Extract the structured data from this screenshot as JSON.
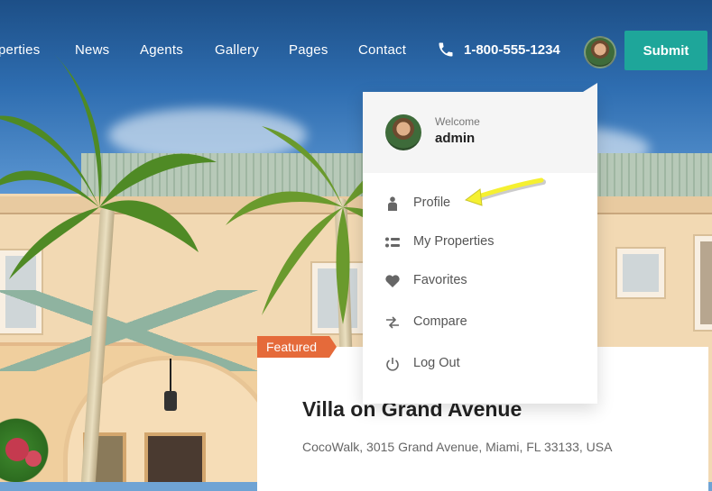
{
  "nav": {
    "items": [
      {
        "label": "perties"
      },
      {
        "label": "News"
      },
      {
        "label": "Agents"
      },
      {
        "label": "Gallery"
      },
      {
        "label": "Pages"
      },
      {
        "label": "Contact"
      }
    ],
    "phone": "1-800-555-1234",
    "phone_icon": "phone-icon",
    "submit_label": "Submit"
  },
  "user_menu": {
    "welcome": "Welcome",
    "username": "admin",
    "items": [
      {
        "label": "Profile",
        "icon": "person-icon"
      },
      {
        "label": "My Properties",
        "icon": "list-icon"
      },
      {
        "label": "Favorites",
        "icon": "heart-icon"
      },
      {
        "label": "Compare",
        "icon": "compare-arrows-icon"
      },
      {
        "label": "Log Out",
        "icon": "power-icon"
      }
    ]
  },
  "property": {
    "badge": "Featured",
    "title": "Villa on Grand Avenue",
    "address": "CocoWalk, 3015 Grand Avenue, Miami, FL 33133, USA"
  },
  "colors": {
    "accent": "#1ea69a",
    "featured": "#e56a3a",
    "annotation_arrow": "#f5f031"
  }
}
